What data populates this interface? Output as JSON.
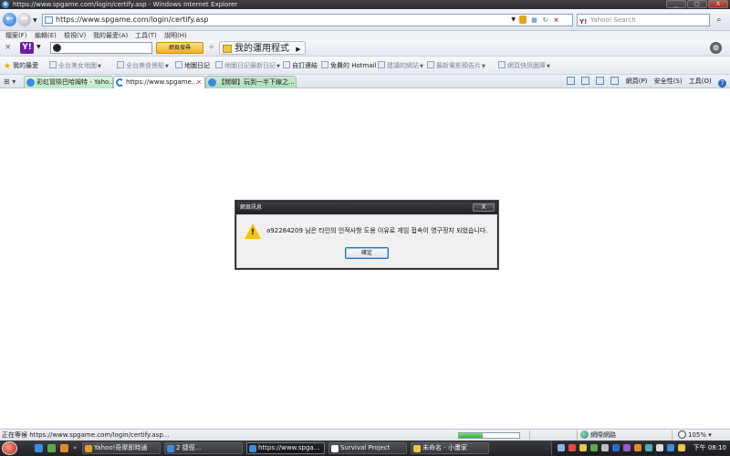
{
  "window": {
    "title": "https://www.spgame.com/login/certify.asp - Windows Internet Explorer",
    "buttons": [
      "_",
      "□",
      "X"
    ]
  },
  "address": {
    "url": "https://www.spgame.com/login/certify.asp",
    "search_placeholder": "Yahoo! Search"
  },
  "menu": [
    "檔案(F)",
    "編輯(E)",
    "檢視(V)",
    "我的最愛(A)",
    "工具(T)",
    "說明(H)"
  ],
  "yahoo_toolbar": {
    "logo": "Y!",
    "search_button": "網頁搜尋",
    "apps_label": "我的運用程式"
  },
  "favorites": {
    "label": "我的最愛",
    "items": [
      {
        "label": "全台美女地圖",
        "dim": true,
        "dropdown": true
      },
      {
        "label": "全台美食景點",
        "dim": true,
        "dropdown": true
      },
      {
        "label": "地圖日記",
        "dim": false,
        "dropdown": false
      },
      {
        "label": "地圖日記最新日記",
        "dim": true,
        "dropdown": true
      },
      {
        "label": "自訂連結",
        "dim": false,
        "dropdown": false
      },
      {
        "label": "免費的 Hotmail",
        "dim": false,
        "dropdown": false
      },
      {
        "label": "建議的網站",
        "dim": true,
        "dropdown": true
      },
      {
        "label": "最新電影預告片",
        "dim": true,
        "dropdown": true
      },
      {
        "label": "網頁快訊圖庫",
        "dim": true,
        "dropdown": true
      }
    ]
  },
  "tabs": [
    {
      "label": "彩虹冒險巴哈姆特 - Yaho..."
    },
    {
      "label": "https://www.spgame..."
    },
    {
      "label": "【閒聊】玩到一半下線之..."
    }
  ],
  "command_bar": {
    "print": "列印(P)",
    "page": "網頁(P)",
    "safety": "安全性(S)",
    "tools": "工具(O)"
  },
  "dialog": {
    "title": "網頁訊息",
    "close": "X",
    "message": "a92284209 님은 타인의 인적사항 도용 이유로 게임 접속이 영구정지 되었습니다.",
    "ok": "確定"
  },
  "status": {
    "text": "正在等候 https://www.spgame.com/login/certify.asp...",
    "progress": 0.4,
    "zone": "網際網路",
    "zoom": "105%"
  },
  "taskbar": {
    "items": [
      {
        "label": "Yahoo!奇摩即時通",
        "active": false,
        "color": "#e0a12a"
      },
      {
        "label": "2 捷徑...",
        "active": false,
        "color": "#3b8de0"
      },
      {
        "label": "https://www.spga...",
        "active": true,
        "color": "#3b8de0"
      },
      {
        "label": "Survival Project",
        "active": false,
        "color": "#ffffff"
      },
      {
        "label": "未命名 - 小畫家",
        "active": false,
        "color": "#f1c445"
      }
    ],
    "clock": "下午 08:10"
  },
  "colors": {
    "warning_yellow": "#f6c400",
    "yahoo_purple": "#6b1fa8",
    "progress_green": "#2fae2f"
  }
}
